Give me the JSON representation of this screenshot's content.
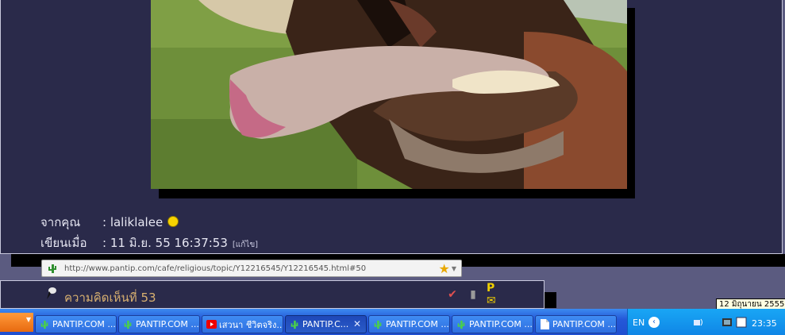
{
  "post": {
    "from_label": "จากคุณ",
    "from_value": ": laliklalee",
    "written_label": "เขียนเมื่อ",
    "written_value": ": 11 มิ.ย. 55 16:37:53",
    "edit_label": "[แก้ไข]"
  },
  "url_bar": {
    "url": "http://www.pantip.com/cafe/religious/topic/Y12216545/Y12216545.html#50"
  },
  "comment": {
    "title": "ความคิดเห็นที่ 53"
  },
  "taskbar": {
    "tasks": [
      {
        "label": "PANTIP.COM ...",
        "icon": "cactus-icon"
      },
      {
        "label": "PANTIP.COM ...",
        "icon": "cactus-icon"
      },
      {
        "label": "เสวนา ชีวิตจริง...",
        "icon": "youtube-icon"
      },
      {
        "label": "PANTIP.C...",
        "icon": "cactus-icon",
        "active": true
      },
      {
        "label": "PANTIP.COM ...",
        "icon": "cactus-icon"
      },
      {
        "label": "PANTIP.COM ...",
        "icon": "cactus-icon"
      },
      {
        "label": "PANTIP.COM ...",
        "icon": "document-icon"
      }
    ],
    "lang": "EN",
    "clock": "23:35",
    "date_tooltip": "12 มิถุนายน 2555"
  },
  "colors": {
    "panel": "#2a2a4a",
    "page_bg": "#5b5b80",
    "taskbar": "#2458d8",
    "tray": "#0f86e6",
    "comment_title": "#d8b070"
  }
}
